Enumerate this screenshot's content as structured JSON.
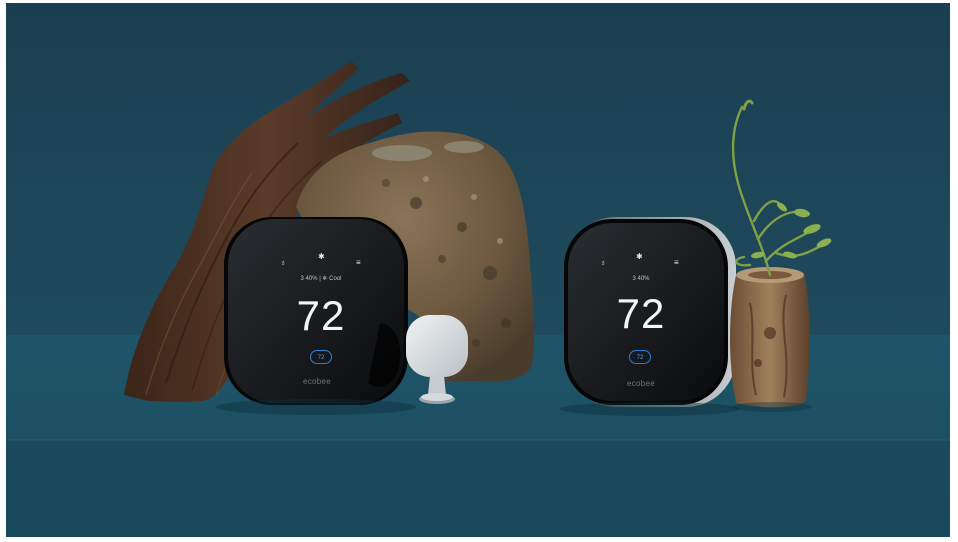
{
  "scene": {
    "left_thermostat": {
      "temperature": "72",
      "status": "3 40%  |  ❄ Cool",
      "setpoint": "72",
      "brand": "ecobee",
      "icons": [
        "person-icon",
        "snowflake-icon",
        "menu-icon"
      ]
    },
    "right_thermostat": {
      "temperature": "72",
      "status": "3 40%",
      "setpoint": "72",
      "brand": "ecobee",
      "icons": [
        "person-icon",
        "snowflake-icon",
        "menu-icon"
      ]
    },
    "colors": {
      "wall": "#1d4356",
      "ledge": "#1e5266",
      "device_glass": "#0b0c0e",
      "accent_blue": "#2f7fd8"
    }
  }
}
